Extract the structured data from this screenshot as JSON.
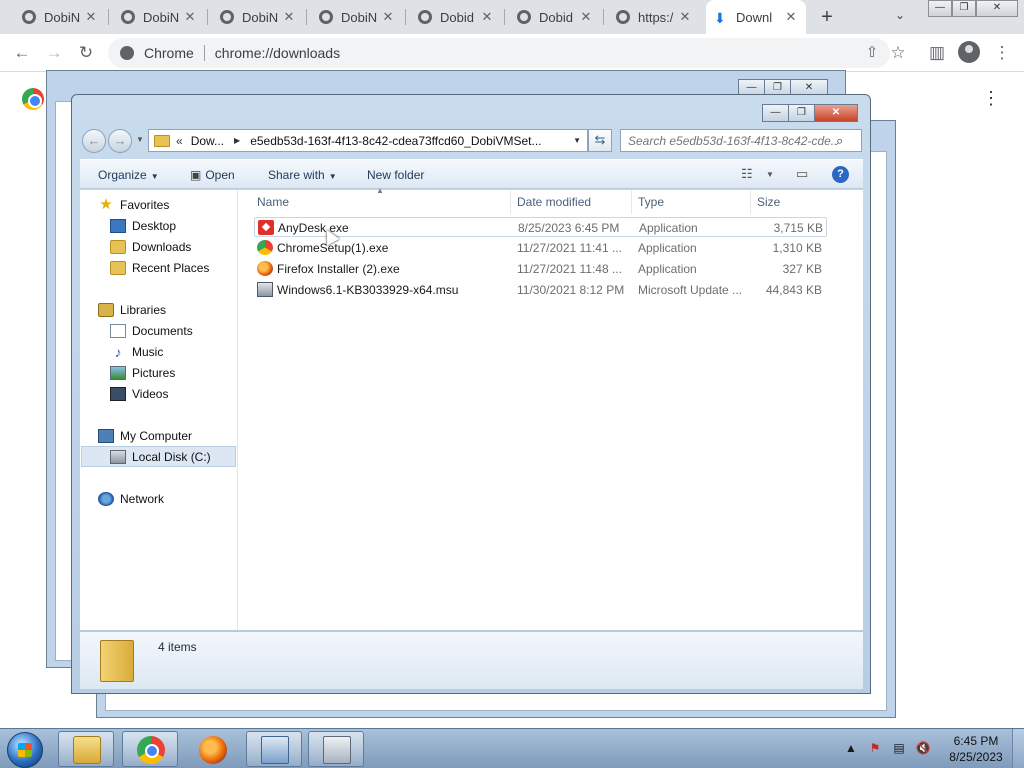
{
  "tabs": [
    {
      "label": "DobiN"
    },
    {
      "label": "DobiN"
    },
    {
      "label": "DobiN"
    },
    {
      "label": "DobiN"
    },
    {
      "label": "Dobid"
    },
    {
      "label": "Dobid"
    },
    {
      "label": "https:/"
    },
    {
      "label": "Downl"
    }
  ],
  "omnibox": {
    "site_name": "Chrome",
    "url": "chrome://downloads"
  },
  "explorer": {
    "address": {
      "prefix": "«",
      "crumb1": "Dow...",
      "crumb2": "e5edb53d-163f-4f13-8c42-cdea73ffcd60_DobiVMSet..."
    },
    "search_placeholder": "Search e5edb53d-163f-4f13-8c42-cde...",
    "commands": {
      "organize": "Organize",
      "open": "Open",
      "share_with": "Share with",
      "new_folder": "New folder"
    },
    "nav": {
      "favorites": "Favorites",
      "desktop": "Desktop",
      "downloads": "Downloads",
      "recent_places": "Recent Places",
      "libraries": "Libraries",
      "documents": "Documents",
      "music": "Music",
      "pictures": "Pictures",
      "videos": "Videos",
      "my_computer": "My Computer",
      "local_disk": "Local Disk (C:)",
      "network": "Network"
    },
    "columns": {
      "name": "Name",
      "date_modified": "Date modified",
      "type": "Type",
      "size": "Size"
    },
    "files": [
      {
        "name": "AnyDesk.exe",
        "date": "8/25/2023 6:45 PM",
        "type": "Application",
        "size": "3,715 KB"
      },
      {
        "name": "ChromeSetup(1).exe",
        "date": "11/27/2021 11:41 ...",
        "type": "Application",
        "size": "1,310 KB"
      },
      {
        "name": "Firefox Installer (2).exe",
        "date": "11/27/2021 11:48 ...",
        "type": "Application",
        "size": "327 KB"
      },
      {
        "name": "Windows6.1-KB3033929-x64.msu",
        "date": "11/30/2021 8:12 PM",
        "type": "Microsoft Update ...",
        "size": "44,843 KB"
      }
    ],
    "details": {
      "count": "4 items"
    }
  },
  "taskbar": {
    "time": "6:45 PM",
    "date": "8/25/2023"
  },
  "icons": {
    "back": "←",
    "forward": "→",
    "reload": "↻",
    "share": "⇧",
    "star": "☆",
    "side_panel": "▥",
    "menu": "⋮",
    "search": "⌕",
    "dropdown": "▼",
    "help": "?"
  }
}
